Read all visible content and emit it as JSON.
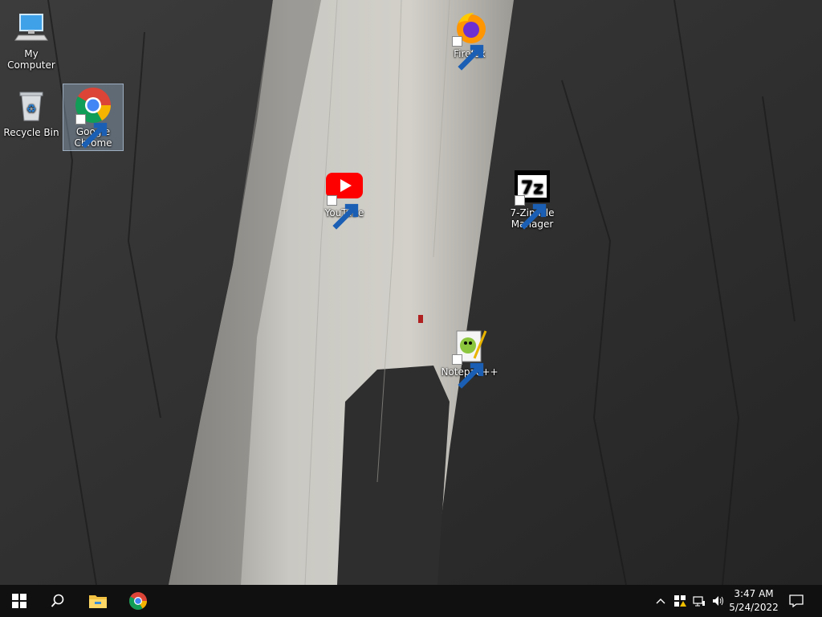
{
  "desktop": {
    "icons": [
      {
        "label": "My Computer",
        "icon": "computer-icon"
      },
      {
        "label": "Recycle Bin",
        "icon": "recycle-bin-icon"
      },
      {
        "label": "Google Chrome",
        "icon": "chrome-icon",
        "selected": true
      },
      {
        "label": "Firefox",
        "icon": "firefox-icon"
      },
      {
        "label": "YouTube",
        "icon": "youtube-icon"
      },
      {
        "label": "7-Zip File Manager",
        "icon": "7zip-icon"
      },
      {
        "label": "Notepad++",
        "icon": "notepadpp-icon"
      }
    ]
  },
  "taskbar": {
    "start": "windows-start-icon",
    "search": "search-icon",
    "pinned": [
      "file-explorer-icon",
      "chrome-icon"
    ],
    "tray": [
      "chevron-up-icon",
      "security-icon",
      "network-icon",
      "volume-icon"
    ],
    "clock": {
      "time": "3:47 AM",
      "date": "5/24/2022"
    },
    "notifications": "notification-icon"
  },
  "colors": {
    "taskbar": "#101010",
    "chrome_red": "#db4437",
    "youtube_red": "#ff0000"
  }
}
